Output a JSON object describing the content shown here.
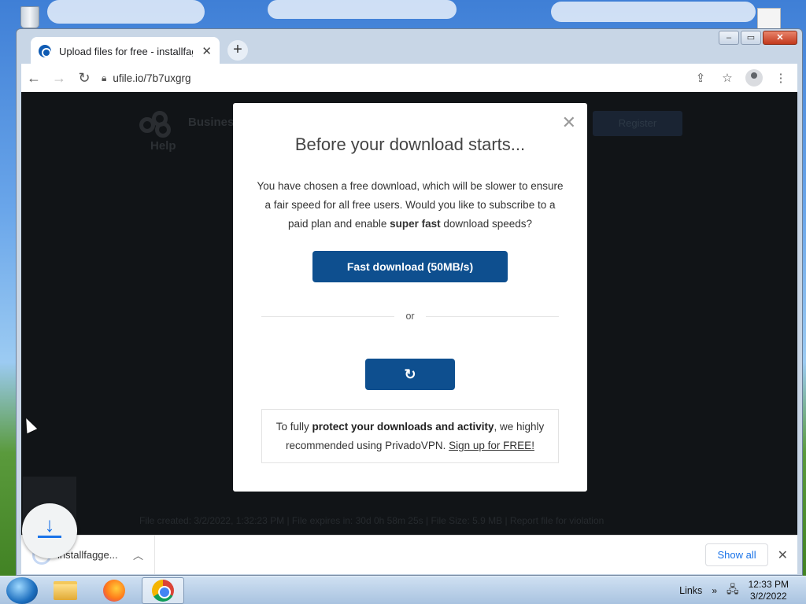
{
  "browser": {
    "tab_title": "Upload files for free - installfaggeer",
    "url": "ufile.io/7b7uxgrg"
  },
  "background": {
    "help_label": "Help",
    "business_label": "Business",
    "register_label": "Register",
    "footer_text": "File created: 3/2/2022, 1:32:23 PM  |  File expires in: 30d 0h 58m 25s  |  File Size: 5.9 MB  |  Report file for violation"
  },
  "modal": {
    "title": "Before your download starts...",
    "text_part1": "You have chosen a free download, which will be slower to ensure a fair speed for all free users. Would you like to subscribe to a paid plan and enable ",
    "text_bold": "super fast",
    "text_part2": " download speeds?",
    "fast_button": "Fast download (50MB/s)",
    "or_label": "or",
    "refresh_icon": "↻",
    "vpn_part1": "To fully ",
    "vpn_bold": "protect your downloads and activity",
    "vpn_part2": ", we highly recommended using PrivadoVPN. ",
    "vpn_link": "Sign up for FREE!"
  },
  "download_bar": {
    "file_name": "installfagge...",
    "show_all": "Show all"
  },
  "taskbar": {
    "links_label": "Links",
    "time": "12:33 PM",
    "date": "3/2/2022"
  }
}
